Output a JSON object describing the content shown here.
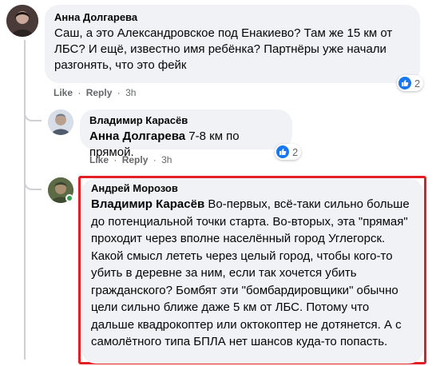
{
  "comments": [
    {
      "author": "Анна Долгарева",
      "text": "Саш, а это Александровское под Енакиево? Там же 15 км от ЛБС? И ещё, известно имя ребёнка? Партнёры уже начали разгонять, что это фейк",
      "like_label": "Like",
      "reply_label": "Reply",
      "time": "3h",
      "reaction_count": "2",
      "reaction_icon": "like-icon",
      "avatar_icon": "user-avatar-icon"
    },
    {
      "author": "Владимир Карасёв",
      "mention": "Анна Долгарева",
      "text": " 7-8 км по прямой.",
      "like_label": "Like",
      "reply_label": "Reply",
      "time": "3h",
      "reaction_count": "2",
      "reaction_icon": "like-icon",
      "avatar_icon": "user-avatar-icon"
    },
    {
      "author": "Андрей Морозов",
      "mention": "Владимир Карасёв",
      "text": " Во-первых, всё-таки сильно больше до потенциальной точки старта. Во-вторых, эта \"прямая\" проходит через вполне населённый город Углегорск. Какой смысл лететь через целый город, чтобы кого-то убить в деревне за ним, если так хочется убить гражданского? Бомбят эти \"бомбардировщики\" обычно цели сильно ближе даже 5 км от ЛБС. Потому что дальше квадрокоптер или октокоптер не дотянется. А с самолётного типа БПЛА нет шансов куда-то попасть.",
      "avatar_icon": "user-avatar-icon",
      "online": true
    }
  ],
  "separator": "·",
  "colors": {
    "bubble": "#f0f2f5",
    "highlight": "#e41e24",
    "like": "#1877f2",
    "online": "#31a24c",
    "meta": "#65676b"
  }
}
